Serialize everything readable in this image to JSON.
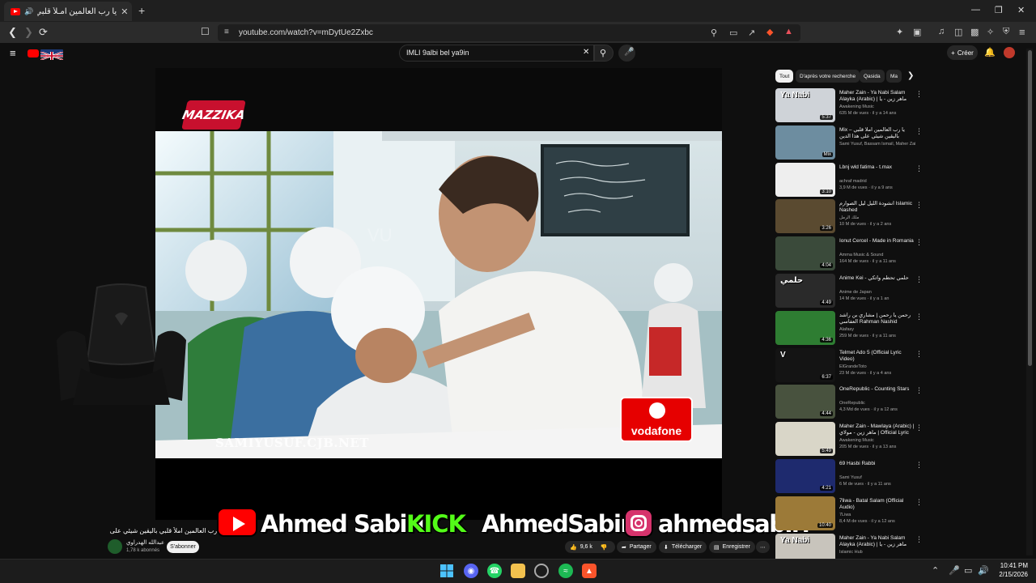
{
  "browser": {
    "tab_title": "يا رب العالمين امـلأ قلبي باليقين",
    "url": "youtube.com/watch?v=mDytUe2Zxbc"
  },
  "youtube": {
    "search_value": "IMLI 9albi bel ya9in",
    "create_label": "Créer"
  },
  "video": {
    "watermark_brand": "MAZZIKA",
    "site_watermark": "SAMIYUSUF.CJB.NET",
    "sponsor": "vodafone",
    "title": "يا رب العالمين املأ قلبي باليقين شيئي على هذا الدين",
    "channel": "عبدالله الهدراوي",
    "subscribers": "1,78 k abonnés",
    "subscribe_label": "S'abonner",
    "likes": "9,6 k",
    "share_label": "Partager",
    "download_label": "Télécharger",
    "save_label": "Enregistrer"
  },
  "overlay": {
    "youtube_handle": "Ahmed Sabiri",
    "kick_label": "KICK",
    "kick_handle": "AhmedSabiri",
    "instagram_handle": "ahmedsabiri"
  },
  "sidebar": {
    "chips": [
      "Tout",
      "D'après votre recherche",
      "Qasida",
      "Ma"
    ],
    "recommendations": [
      {
        "title": "Maher Zain - Ya Nabi Salam Alayka (Arabic) | ماهر زين - يا نبي سلام عليك",
        "channel": "Awakening Music",
        "meta": "635 M de vues · il y a 14 ans",
        "duration": "5:37",
        "thumb_text": "Ya Nabi",
        "bg": "#cfd3d8"
      },
      {
        "title": "Mix – يا رب العالمين املأ قلبي باليقين شيئي على هذا الدين YouTube",
        "channel": "Sami Yusuf, Bassam Ismail, Maher Zain et",
        "meta": "",
        "duration": "Mix",
        "thumb_text": "",
        "bg": "#6d8da0"
      },
      {
        "title": "Lbnj wld fatima - t.max",
        "channel": "achraf madrid",
        "meta": "3,9 M de vues · il y a 9 ans",
        "duration": "3:10",
        "thumb_text": "",
        "bg": "#eeeeee"
      },
      {
        "title": "أنشودة الليل ليل الصوارم Islamic Nashed",
        "channel": "ملك الرمل",
        "meta": "10 M de vues · il y a 2 ans",
        "duration": "3:26",
        "thumb_text": "",
        "bg": "#5a4a30"
      },
      {
        "title": "Ionut Cercel - Made in Romania",
        "channel": "Amma Music & Sound",
        "meta": "164 M de vues · il y a 11 ans",
        "duration": "4:04",
        "thumb_text": "",
        "bg": "#3a4a3a"
      },
      {
        "title": "Anime Kei - حلمي تحطم واتكي",
        "channel": "Anime de Japan",
        "meta": "14 M de vues · il y a 1 an",
        "duration": "4:49",
        "thumb_text": "حلمي",
        "bg": "#2a2a2a"
      },
      {
        "title": "رحمن يا رحمن | مشاري بن راشد العفاسي Rahman Nashid Mishary Alafasy",
        "channel": "Alafasy",
        "meta": "259 M de vues · il y a 11 ans",
        "duration": "4:36",
        "thumb_text": "",
        "bg": "#2e7d32"
      },
      {
        "title": "Telmet Ado 5 (Official Lyric Video)",
        "channel": "ElGrandeToto",
        "meta": "23 M de vues · il y a 4 ans",
        "duration": "6:37",
        "thumb_text": "V",
        "bg": "#141414"
      },
      {
        "title": "OneRepublic - Counting Stars",
        "channel": "OneRepublic",
        "meta": "4,3 Md de vues · il y a 12 ans",
        "duration": "4:44",
        "thumb_text": "",
        "bg": "#48523e"
      },
      {
        "title": "Maher Zain - Mawlaya (Arabic) | ماهر زين - مولاي | Official Lyric Video",
        "channel": "Awakening Music",
        "meta": "205 M de vues · il y a 13 ans",
        "duration": "5:49",
        "thumb_text": "",
        "bg": "#d9d6c8"
      },
      {
        "title": "69 Hasbi Rabbi",
        "channel": "Sami Yusuf",
        "meta": "6 M de vues · il y a 11 ans",
        "duration": "4:21",
        "thumb_text": "",
        "bg": "#1e2a6e"
      },
      {
        "title": "7liwa - Batal Salam (Official Audio)",
        "channel": "7Liwa",
        "meta": "8,4 M de vues · il y a 12 ans",
        "duration": "10:40",
        "thumb_text": "",
        "bg": "#9c7a38"
      },
      {
        "title": "Maher Zain - Ya Nabi Salam Alayka (Arabic) | ماهر زين - يا نبي سلام",
        "channel": "Islamic Hub",
        "meta": "",
        "duration": "",
        "thumb_text": "Ya Nabi",
        "bg": "#c8c4bc"
      }
    ]
  },
  "taskbar": {
    "time": "10:41 PM",
    "date": "2/15/2026"
  }
}
